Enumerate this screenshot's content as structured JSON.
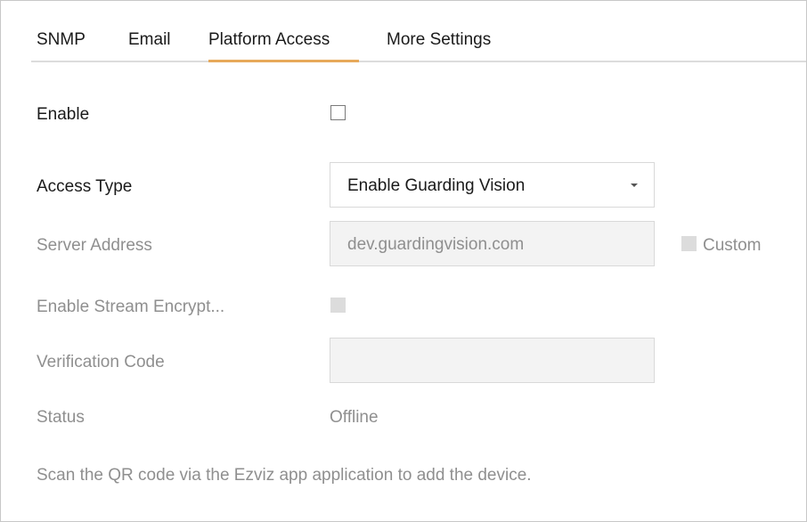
{
  "tabs": {
    "snmp": "SNMP",
    "email": "Email",
    "platform_access": "Platform Access",
    "more_settings": "More Settings",
    "active": "Platform Access"
  },
  "form": {
    "enable": {
      "label": "Enable",
      "checked": false
    },
    "access_type": {
      "label": "Access Type",
      "value": "Enable Guarding Vision"
    },
    "server_address": {
      "label": "Server Address",
      "value": "dev.guardingvision.com",
      "custom_label": "Custom",
      "custom_checked": false
    },
    "stream_encryption": {
      "label": "Enable Stream Encrypt...",
      "checked": false
    },
    "verification_code": {
      "label": "Verification Code",
      "value": ""
    },
    "status": {
      "label": "Status",
      "value": "Offline"
    }
  },
  "hint": "Scan the QR code via the Ezviz app application to add the device.",
  "colors": {
    "accent_underline": "#e7a95a",
    "text_primary": "#1a1a1a",
    "text_disabled": "#8f8f8f"
  }
}
